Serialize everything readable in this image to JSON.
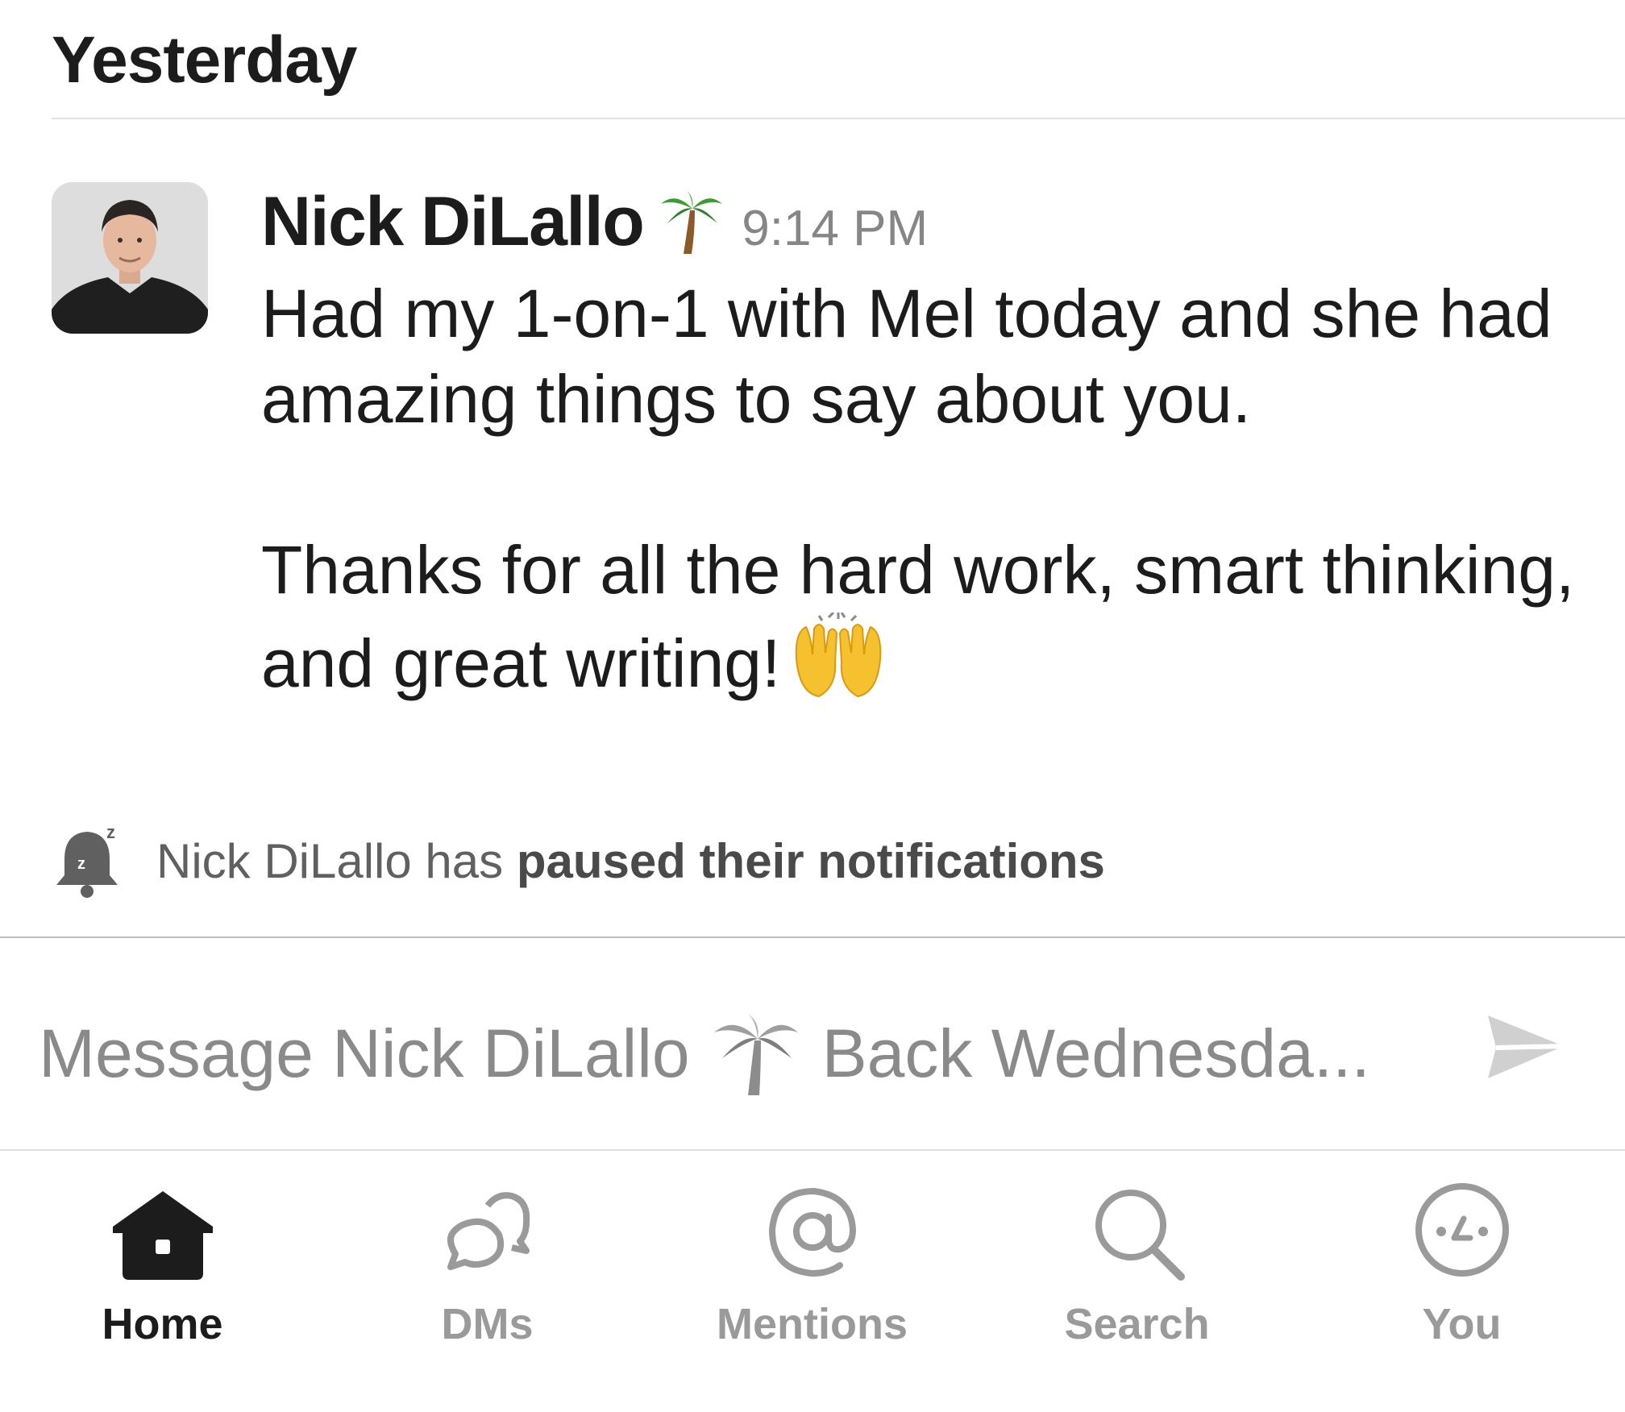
{
  "day_header": "Yesterday",
  "message": {
    "sender": "Nick DiLallo",
    "status_emoji": "palm-tree",
    "time": "9:14 PM",
    "paragraph1": "Had my 1-on-1 with Mel today and she had amazing things to say about you.",
    "paragraph2": "Thanks for all the hard work, smart thinking, and great writing!",
    "reaction_emoji": "raising-hands"
  },
  "notice": {
    "prefix": "Nick DiLallo has",
    "emphasis": "paused their notifications"
  },
  "composer": {
    "placeholder_prefix": "Message Nick DiLallo",
    "placeholder_suffix": "Back Wednesda...",
    "placeholder_full": "Message Nick DiLallo 🌴 Back Wednesda..."
  },
  "tabs": [
    {
      "label": "Home",
      "icon": "home-icon",
      "active": true
    },
    {
      "label": "DMs",
      "icon": "dms-icon",
      "active": false
    },
    {
      "label": "Mentions",
      "icon": "mentions-icon",
      "active": false
    },
    {
      "label": "Search",
      "icon": "search-icon",
      "active": false
    },
    {
      "label": "You",
      "icon": "you-icon",
      "active": false
    }
  ],
  "colors": {
    "text_primary": "#1d1c1d",
    "text_muted": "#868686",
    "tab_inactive": "#9a9a9a"
  }
}
